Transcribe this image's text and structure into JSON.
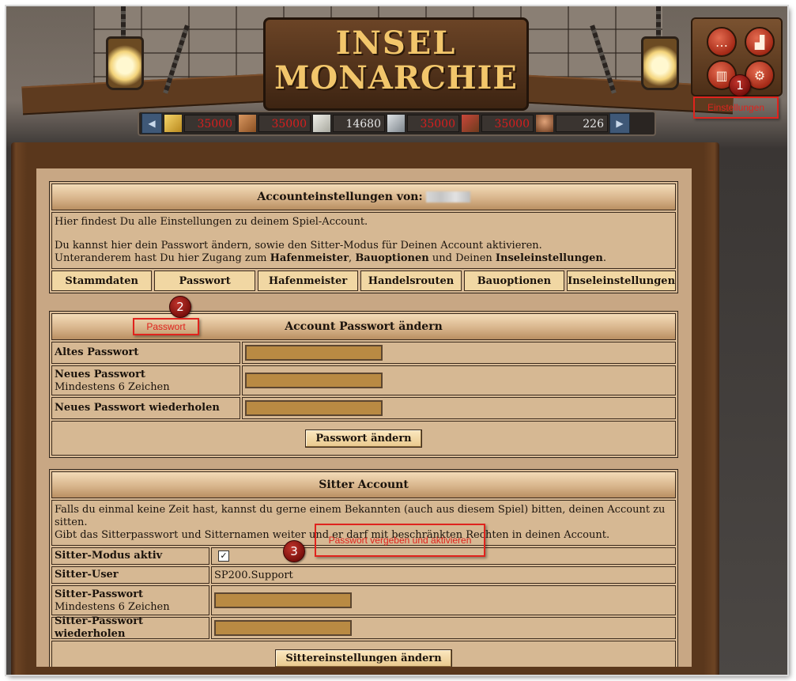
{
  "header": {
    "logo_line1": "INSEL",
    "logo_line2": "MONARCHIE"
  },
  "resources": [
    {
      "icon": "gold-bar-icon",
      "value": "35000",
      "color": "#d81e1e"
    },
    {
      "icon": "copper-bar-icon",
      "value": "35000",
      "color": "#d81e1e"
    },
    {
      "icon": "stone-icon",
      "value": "14680",
      "color": "#e6e6e6"
    },
    {
      "icon": "iron-bar-icon",
      "value": "35000",
      "color": "#d81e1e"
    },
    {
      "icon": "tools-icon",
      "value": "35000",
      "color": "#d81e1e"
    },
    {
      "icon": "population-icon",
      "value": "226",
      "color": "#e6e6e6"
    }
  ],
  "annotations": {
    "step1": "1",
    "step2": "2",
    "step3": "3",
    "einstellungen": "Einstellungen",
    "passwort": "Passwort",
    "sitter_hint": "Passwort vergeben und aktivieren"
  },
  "account": {
    "title": "Accounteinstellungen von:",
    "intro1": "Hier findest Du alle Einstellungen zu deinem Spiel-Account.",
    "intro2": "Du kannst hier dein Passwort ändern, sowie den Sitter-Modus für Deinen Account aktivieren.",
    "intro3a": "Unteranderem hast Du hier Zugang zum ",
    "intro3b": "Hafenmeister",
    "intro3c": ", ",
    "intro3d": "Bauoptionen",
    "intro3e": " und Deinen ",
    "intro3f": "Inseleinstellungen",
    "intro3g": ".",
    "tabs": [
      "Stammdaten",
      "Passwort",
      "Hafenmeister",
      "Handelsrouten",
      "Bauoptionen",
      "Inseleinstellungen"
    ]
  },
  "password": {
    "title": "Account Passwort ändern",
    "old_label": "Altes Passwort",
    "new_label": "Neues Passwort",
    "new_hint": "Mindestens 6 Zeichen",
    "repeat_label": "Neues Passwort wiederholen",
    "button": "Passwort ändern"
  },
  "sitter": {
    "title": "Sitter Account",
    "desc1": "Falls du einmal keine Zeit hast, kannst du gerne einem Bekannten (auch aus diesem Spiel) bitten, deinen Account zu sitten.",
    "desc2": "Gibt das Sitterpasswort und Sitternamen weiter und er darf mit beschränkten Rechten in deinen Account.",
    "mode_label": "Sitter-Modus aktiv",
    "mode_checked": "✓",
    "user_label": "Sitter-User",
    "user_value": "SP200.Support",
    "pw_label": "Sitter-Passwort",
    "pw_hint": "Mindestens 6 Zeichen",
    "pw_repeat_label": "Sitter-Passwort wiederholen",
    "button": "Sittereinstellungen ändern"
  }
}
